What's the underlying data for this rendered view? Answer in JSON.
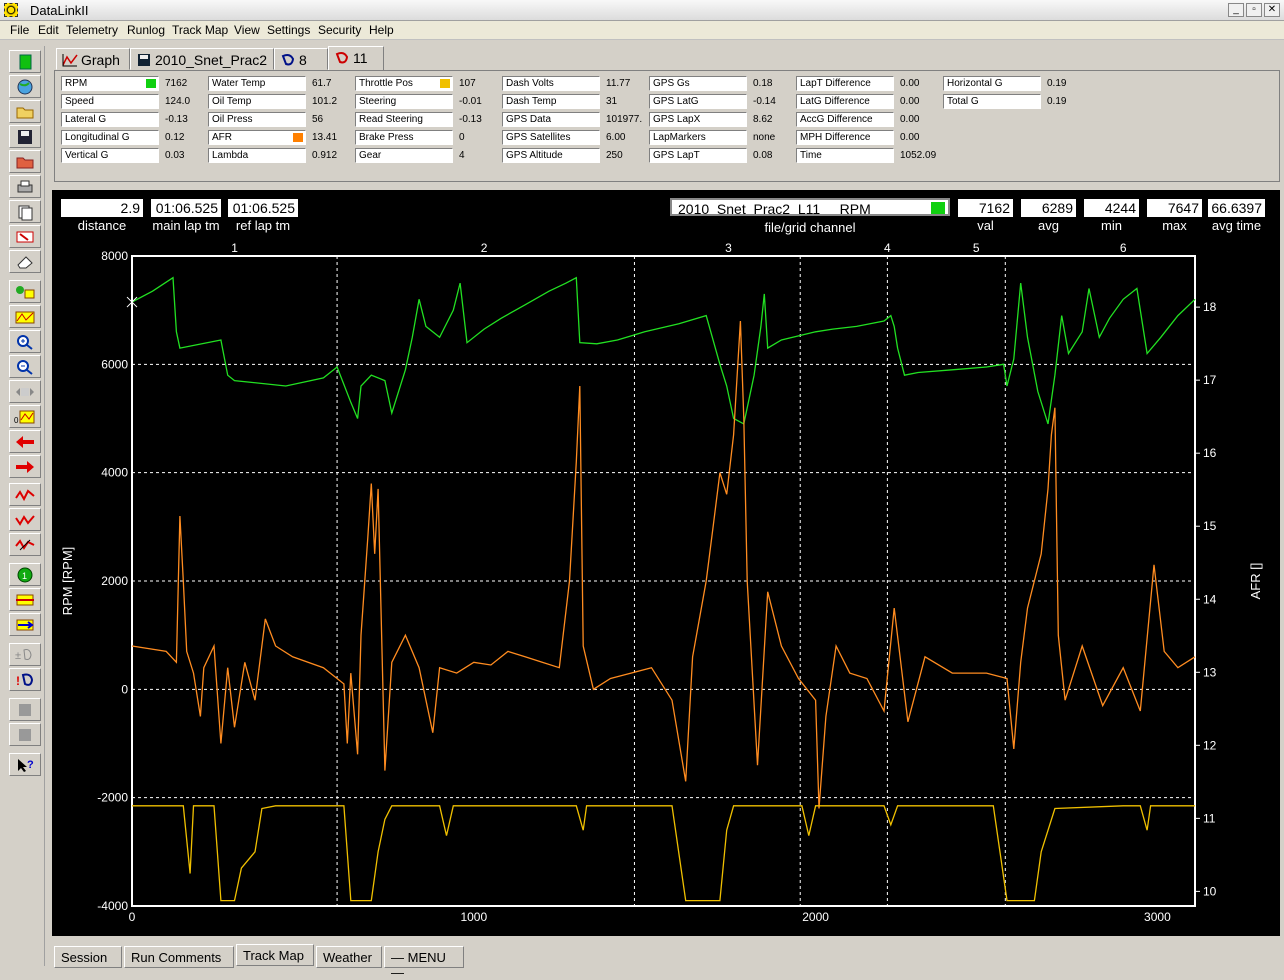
{
  "window": {
    "title": "DataLinkII"
  },
  "menu": [
    "File",
    "Edit",
    "Telemetry",
    "Runlog",
    "Track Map",
    "View",
    "Settings",
    "Security",
    "Help"
  ],
  "tabs": [
    {
      "label": "Graph",
      "icon": "graph-icon"
    },
    {
      "label": "2010_Snet_Prac2",
      "icon": "save-disk-icon"
    },
    {
      "label": "8",
      "icon": "lap-flag-icon"
    },
    {
      "label": "11",
      "icon": "lap-flag-icon"
    }
  ],
  "channels": {
    "col1": [
      {
        "label": "RPM",
        "value": "7162",
        "indicator": "#10d010"
      },
      {
        "label": "Speed",
        "value": "124.0"
      },
      {
        "label": "Lateral G",
        "value": "-0.13"
      },
      {
        "label": "Longitudinal G",
        "value": "0.12"
      },
      {
        "label": "Vertical G",
        "value": "0.03"
      }
    ],
    "col2": [
      {
        "label": "Water Temp",
        "value": "61.7"
      },
      {
        "label": "Oil Temp",
        "value": "101.2"
      },
      {
        "label": "Oil Press",
        "value": "56"
      },
      {
        "label": "AFR",
        "value": "13.41",
        "indicator": "#ff8000"
      },
      {
        "label": "Lambda",
        "value": "0.912"
      }
    ],
    "col3": [
      {
        "label": "Throttle Pos",
        "value": "107",
        "indicator": "#f0c000"
      },
      {
        "label": "Steering",
        "value": "-0.01"
      },
      {
        "label": "Read Steering",
        "value": "-0.13"
      },
      {
        "label": "Brake Press",
        "value": "0"
      },
      {
        "label": "Gear",
        "value": "4"
      }
    ],
    "col4": [
      {
        "label": "Dash Volts",
        "value": "11.77"
      },
      {
        "label": "Dash Temp",
        "value": "31"
      },
      {
        "label": "GPS Data",
        "value": "101977."
      },
      {
        "label": "GPS Satellites",
        "value": "6.00"
      },
      {
        "label": "GPS Altitude",
        "value": "250"
      }
    ],
    "col5": [
      {
        "label": "GPS Gs",
        "value": "0.18"
      },
      {
        "label": "GPS LatG",
        "value": "-0.14"
      },
      {
        "label": "GPS LapX",
        "value": "8.62"
      },
      {
        "label": "LapMarkers",
        "value": "none"
      },
      {
        "label": "GPS LapT",
        "value": "0.08"
      }
    ],
    "col6": [
      {
        "label": "LapT Difference",
        "value": "0.00"
      },
      {
        "label": "LatG Difference",
        "value": "0.00"
      },
      {
        "label": "AccG Difference",
        "value": "0.00"
      },
      {
        "label": "MPH Difference",
        "value": "0.00"
      },
      {
        "label": "Time",
        "value": "1052.09"
      }
    ],
    "col7": [
      {
        "label": "Horizontal G",
        "value": "0.19"
      },
      {
        "label": "Total G",
        "value": "0.19"
      }
    ]
  },
  "readouts": {
    "distance": {
      "value": "2.9",
      "caption": "distance"
    },
    "main_lap": {
      "value": "01:06.525",
      "caption": "main lap tm"
    },
    "ref_lap": {
      "value": "01:06.525",
      "caption": "ref lap tm"
    },
    "channel": {
      "value": "2010_Snet_Prac2_L11     RPM",
      "caption": "file/grid channel",
      "indicator": "#10d010"
    },
    "val": {
      "value": "7162",
      "caption": "val"
    },
    "avg": {
      "value": "6289",
      "caption": "avg"
    },
    "min": {
      "value": "4244",
      "caption": "min"
    },
    "max": {
      "value": "7647",
      "caption": "max"
    },
    "avg_time": {
      "value": "66.6397",
      "caption": "avg time"
    }
  },
  "chart_data": {
    "type": "line",
    "xlim": [
      0,
      3110
    ],
    "x_ticks": [
      "0",
      "1000",
      "2000",
      "3000"
    ],
    "ylabel_left": "RPM [RPM]",
    "ylim_left": [
      -4000,
      8000
    ],
    "y_ticks_left": [
      "8000",
      "6000",
      "4000",
      "2000",
      "0",
      "-2000",
      "-4000"
    ],
    "ylabel_right": "AFR []",
    "ylim_right": [
      9.8,
      18.7
    ],
    "y_ticks_right": [
      "18",
      "17",
      "16",
      "15",
      "14",
      "13",
      "12",
      "11",
      "10"
    ],
    "grid": true,
    "corner_markers": [
      {
        "label": "1",
        "x": 300
      },
      {
        "label": "2",
        "x": 1030
      },
      {
        "label": "3",
        "x": 1745
      },
      {
        "label": "4",
        "x": 2210
      },
      {
        "label": "5",
        "x": 2470
      },
      {
        "label": "6",
        "x": 2900
      }
    ],
    "colors": {
      "rpm": "#22e022",
      "afr": "#ff8c20",
      "throttle": "#f0c000",
      "grid": "#ffffff",
      "background": "#000000"
    },
    "series": [
      {
        "axis": "left",
        "color": "#22e022",
        "points": [
          [
            0,
            7150
          ],
          [
            60,
            7350
          ],
          [
            120,
            7600
          ],
          [
            130,
            6600
          ],
          [
            140,
            6300
          ],
          [
            260,
            6450
          ],
          [
            280,
            5800
          ],
          [
            300,
            5700
          ],
          [
            450,
            5600
          ],
          [
            560,
            5750
          ],
          [
            600,
            5950
          ],
          [
            640,
            5300
          ],
          [
            660,
            5000
          ],
          [
            670,
            5600
          ],
          [
            700,
            5800
          ],
          [
            740,
            5700
          ],
          [
            760,
            5100
          ],
          [
            800,
            5900
          ],
          [
            820,
            6500
          ],
          [
            840,
            7200
          ],
          [
            860,
            6700
          ],
          [
            900,
            6500
          ],
          [
            940,
            7000
          ],
          [
            960,
            7500
          ],
          [
            980,
            6400
          ],
          [
            1030,
            6650
          ],
          [
            1080,
            6850
          ],
          [
            1150,
            7100
          ],
          [
            1220,
            7350
          ],
          [
            1270,
            7500
          ],
          [
            1300,
            7600
          ],
          [
            1310,
            6400
          ],
          [
            1360,
            6380
          ],
          [
            1420,
            6450
          ],
          [
            1500,
            6600
          ],
          [
            1600,
            6750
          ],
          [
            1680,
            6900
          ],
          [
            1720,
            6000
          ],
          [
            1740,
            5600
          ],
          [
            1760,
            5000
          ],
          [
            1790,
            4900
          ],
          [
            1820,
            5800
          ],
          [
            1840,
            6700
          ],
          [
            1850,
            7300
          ],
          [
            1860,
            6300
          ],
          [
            1900,
            6450
          ],
          [
            2000,
            6600
          ],
          [
            2050,
            6650
          ],
          [
            2120,
            6700
          ],
          [
            2200,
            6800
          ],
          [
            2220,
            6900
          ],
          [
            2230,
            6700
          ],
          [
            2240,
            6300
          ],
          [
            2260,
            5800
          ],
          [
            2300,
            5850
          ],
          [
            2400,
            5900
          ],
          [
            2500,
            5950
          ],
          [
            2550,
            6000
          ],
          [
            2560,
            5600
          ],
          [
            2580,
            6100
          ],
          [
            2600,
            7500
          ],
          [
            2620,
            6500
          ],
          [
            2650,
            5500
          ],
          [
            2680,
            4900
          ],
          [
            2700,
            5800
          ],
          [
            2720,
            6900
          ],
          [
            2740,
            6200
          ],
          [
            2780,
            6600
          ],
          [
            2800,
            7400
          ],
          [
            2830,
            6500
          ],
          [
            2860,
            6850
          ],
          [
            2900,
            7200
          ],
          [
            2940,
            7400
          ],
          [
            2970,
            6200
          ],
          [
            3010,
            6500
          ],
          [
            3060,
            6900
          ],
          [
            3110,
            7200
          ]
        ]
      },
      {
        "axis": "left",
        "color": "#ff8c20",
        "points": [
          [
            0,
            800
          ],
          [
            100,
            700
          ],
          [
            130,
            500
          ],
          [
            140,
            3200
          ],
          [
            150,
            2000
          ],
          [
            160,
            700
          ],
          [
            180,
            300
          ],
          [
            200,
            -500
          ],
          [
            210,
            400
          ],
          [
            240,
            800
          ],
          [
            260,
            -1000
          ],
          [
            280,
            400
          ],
          [
            300,
            -700
          ],
          [
            330,
            500
          ],
          [
            360,
            -200
          ],
          [
            390,
            1300
          ],
          [
            420,
            800
          ],
          [
            470,
            600
          ],
          [
            560,
            400
          ],
          [
            620,
            100
          ],
          [
            630,
            -1000
          ],
          [
            640,
            300
          ],
          [
            660,
            -1200
          ],
          [
            670,
            1000
          ],
          [
            690,
            2800
          ],
          [
            700,
            3800
          ],
          [
            710,
            2500
          ],
          [
            720,
            3700
          ],
          [
            740,
            -1500
          ],
          [
            760,
            500
          ],
          [
            800,
            1000
          ],
          [
            840,
            400
          ],
          [
            880,
            -800
          ],
          [
            900,
            400
          ],
          [
            950,
            300
          ],
          [
            1000,
            500
          ],
          [
            1050,
            450
          ],
          [
            1100,
            700
          ],
          [
            1150,
            600
          ],
          [
            1200,
            500
          ],
          [
            1250,
            400
          ],
          [
            1280,
            2000
          ],
          [
            1300,
            4200
          ],
          [
            1310,
            5600
          ],
          [
            1320,
            800
          ],
          [
            1350,
            0
          ],
          [
            1400,
            200
          ],
          [
            1460,
            300
          ],
          [
            1520,
            400
          ],
          [
            1580,
            -200
          ],
          [
            1620,
            -1700
          ],
          [
            1640,
            600
          ],
          [
            1680,
            2000
          ],
          [
            1700,
            3000
          ],
          [
            1720,
            4000
          ],
          [
            1740,
            3600
          ],
          [
            1760,
            4700
          ],
          [
            1780,
            6800
          ],
          [
            1790,
            5000
          ],
          [
            1800,
            2000
          ],
          [
            1830,
            -1400
          ],
          [
            1860,
            1800
          ],
          [
            1900,
            800
          ],
          [
            1950,
            200
          ],
          [
            2000,
            -200
          ],
          [
            2010,
            -2200
          ],
          [
            2030,
            -500
          ],
          [
            2060,
            800
          ],
          [
            2100,
            300
          ],
          [
            2150,
            200
          ],
          [
            2200,
            -400
          ],
          [
            2230,
            1500
          ],
          [
            2270,
            -600
          ],
          [
            2320,
            600
          ],
          [
            2400,
            300
          ],
          [
            2500,
            300
          ],
          [
            2560,
            200
          ],
          [
            2580,
            -1100
          ],
          [
            2600,
            500
          ],
          [
            2620,
            1500
          ],
          [
            2660,
            2500
          ],
          [
            2680,
            3700
          ],
          [
            2690,
            4700
          ],
          [
            2700,
            5200
          ],
          [
            2710,
            1000
          ],
          [
            2730,
            -200
          ],
          [
            2780,
            800
          ],
          [
            2840,
            -300
          ],
          [
            2900,
            400
          ],
          [
            2950,
            -400
          ],
          [
            2990,
            2300
          ],
          [
            3020,
            700
          ],
          [
            3060,
            400
          ],
          [
            3110,
            600
          ]
        ]
      },
      {
        "axis": "left",
        "color": "#f0c000",
        "points": [
          [
            0,
            -2150
          ],
          [
            150,
            -2150
          ],
          [
            170,
            -3400
          ],
          [
            180,
            -2150
          ],
          [
            240,
            -2150
          ],
          [
            260,
            -3900
          ],
          [
            300,
            -3900
          ],
          [
            320,
            -3300
          ],
          [
            360,
            -3000
          ],
          [
            380,
            -2200
          ],
          [
            420,
            -2150
          ],
          [
            560,
            -2150
          ],
          [
            620,
            -2150
          ],
          [
            640,
            -3900
          ],
          [
            700,
            -3900
          ],
          [
            720,
            -3000
          ],
          [
            740,
            -2400
          ],
          [
            760,
            -2150
          ],
          [
            900,
            -2150
          ],
          [
            920,
            -2700
          ],
          [
            940,
            -2150
          ],
          [
            1300,
            -2150
          ],
          [
            1320,
            -2600
          ],
          [
            1330,
            -2150
          ],
          [
            1580,
            -2150
          ],
          [
            1620,
            -3900
          ],
          [
            1720,
            -3900
          ],
          [
            1740,
            -2600
          ],
          [
            1760,
            -2150
          ],
          [
            1960,
            -2150
          ],
          [
            1980,
            -2700
          ],
          [
            2000,
            -2150
          ],
          [
            2200,
            -2150
          ],
          [
            2220,
            -2500
          ],
          [
            2240,
            -2150
          ],
          [
            2520,
            -2150
          ],
          [
            2560,
            -3900
          ],
          [
            2640,
            -3900
          ],
          [
            2660,
            -3000
          ],
          [
            2700,
            -2200
          ],
          [
            2900,
            -2150
          ],
          [
            2950,
            -2150
          ],
          [
            2970,
            -2600
          ],
          [
            2980,
            -2150
          ],
          [
            3110,
            -2150
          ]
        ]
      }
    ]
  },
  "bottom_tabs": [
    "Session",
    "Run Comments",
    "Track Map",
    "Weather",
    "— MENU —"
  ]
}
